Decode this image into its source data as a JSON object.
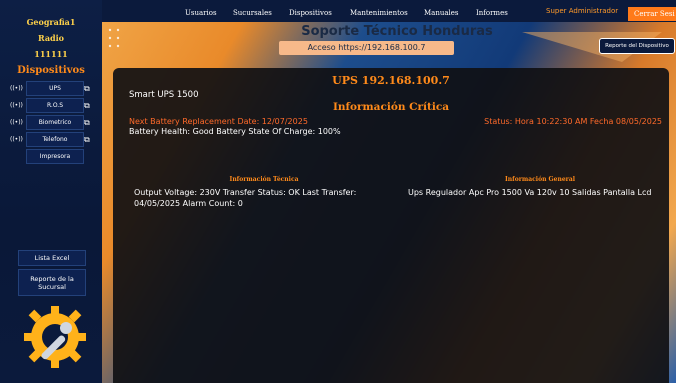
{
  "sidebar": {
    "top_lines": [
      "Geografia1",
      "Radio",
      "111111"
    ],
    "heading": "Dispositivos",
    "devices": [
      {
        "label": "UPS",
        "icon": "signal-icon",
        "ext_icon": "external-link-icon"
      },
      {
        "label": "R.O.S",
        "icon": "signal-icon",
        "ext_icon": "external-link-icon"
      },
      {
        "label": "Biometrico",
        "icon": "signal-icon",
        "ext_icon": "external-link-icon"
      },
      {
        "label": "Telefono",
        "icon": "signal-icon",
        "ext_icon": "external-link-icon"
      }
    ],
    "printer_label": "Impresora",
    "excel_label": "Lista Excel",
    "report_label": "Reporte de la Sucursal",
    "logo_icon": "gear-wrench-icon"
  },
  "topbar": {
    "menu": [
      "Usuarios",
      "Sucursales",
      "Dispositivos",
      "Mantenimientos",
      "Manuales",
      "Informes"
    ],
    "user_role": "Super Administrador",
    "logout_label": "Cerrar Sesi"
  },
  "header": {
    "title": "Soporte Técnico Honduras",
    "access": "Acceso https://192.168.100.7",
    "device_report_label": "Reporte del Dispositivo"
  },
  "panel": {
    "title": "UPS 192.168.100.7",
    "model": "Smart UPS 1500",
    "critical_heading": "Información Crítica",
    "next_battery": "Next Battery Replacement Date: 12/07/2025",
    "status": "Status: Hora 10:22:30 AM Fecha 08/05/2025",
    "health": "Battery Health: Good Battery State Of Charge: 100%",
    "tech_heading": "Información Técnica",
    "tech_body": "Output Voltage: 230V Transfer Status: OK Last Transfer: 04/05/2025 Alarm Count: 0",
    "general_heading": "Información General",
    "general_body": "Ups Regulador Apc Pro 1500 Va 120v 10 Salidas Pantalla Lcd"
  },
  "colors": {
    "accent": "#ff8a1a",
    "alert": "#ff6a2a",
    "nav_bg": "#0b1a3c",
    "panel_bg": "#101014"
  }
}
